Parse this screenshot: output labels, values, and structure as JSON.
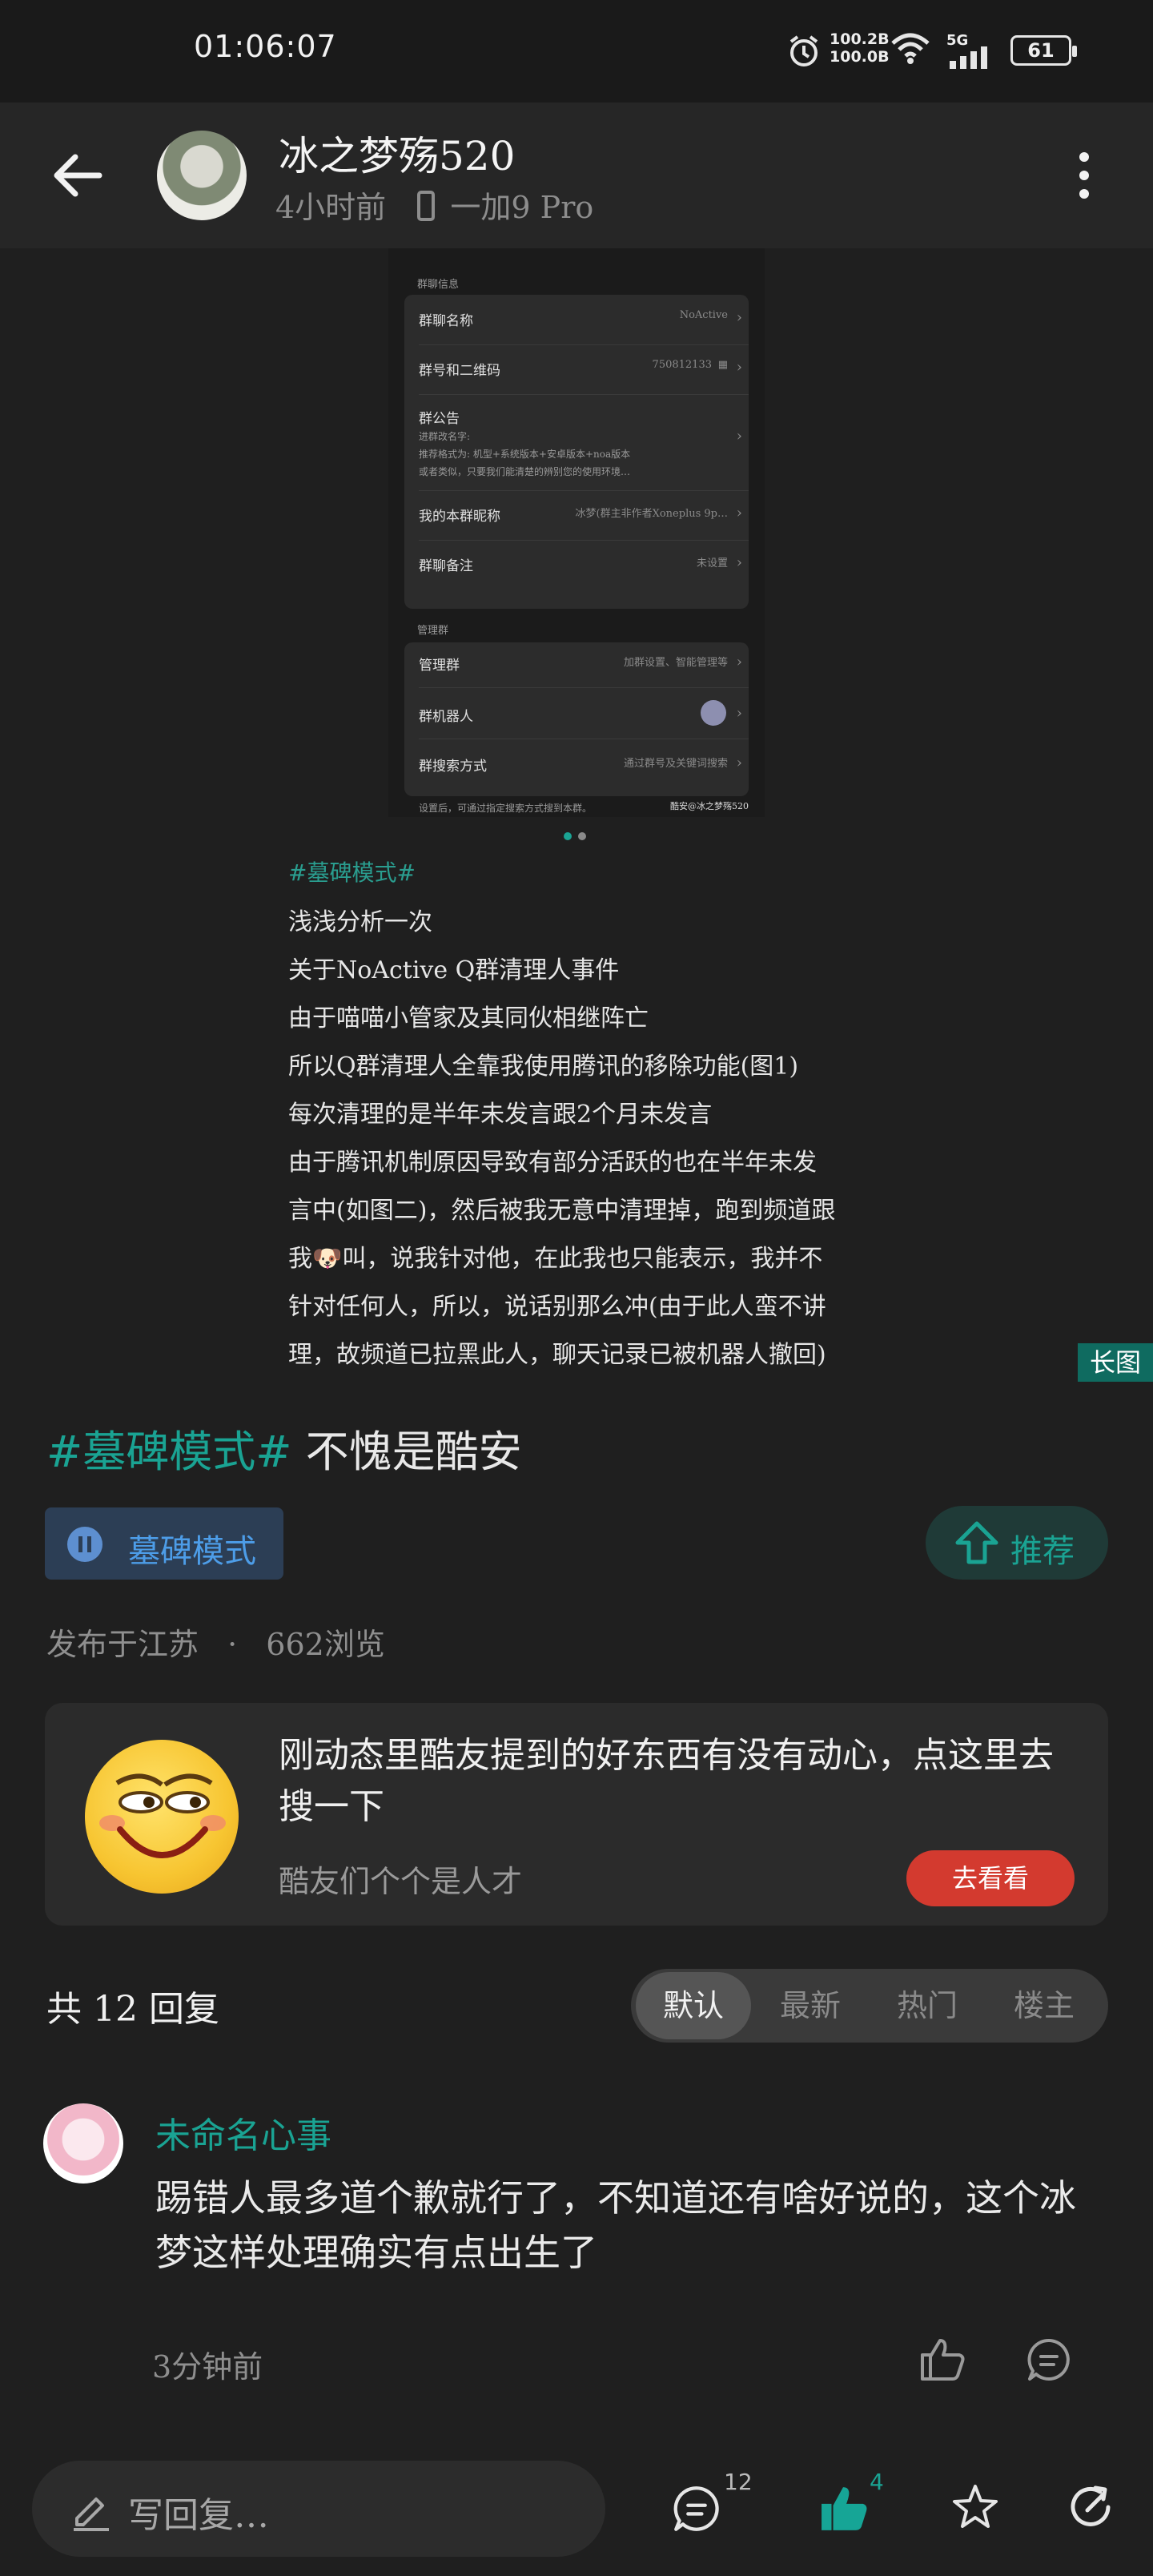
{
  "status_bar": {
    "time": "01:06:07",
    "net_up": "100.2B",
    "net_down": "100.0B",
    "network": "5G",
    "battery": "61"
  },
  "header": {
    "author": "冰之梦殇520",
    "time_ago": "4小时前",
    "device": "一加9 Pro"
  },
  "screenshot": {
    "section_label": "群聊信息",
    "rows": [
      {
        "label": "群聊名称",
        "value": "NoActive"
      },
      {
        "label": "群号和二维码",
        "value": "750812133"
      },
      {
        "label": "群公告",
        "lines": [
          "进群改名字:",
          "推荐格式为: 机型+系统版本+安卓版本+noa版本",
          "或者类似，只要我们能清楚的辨别您的使用环境…"
        ]
      },
      {
        "label": "我的本群昵称",
        "value": "冰梦(群主非作者Xoneplus 9p…"
      },
      {
        "label": "群聊备注",
        "value": "未设置"
      }
    ],
    "section2_label": "管理群",
    "rows2": [
      {
        "label": "管理群",
        "value": "加群设置、智能管理等"
      },
      {
        "label": "群机器人",
        "value": ""
      },
      {
        "label": "群搜索方式",
        "value": "通过群号及关键词搜索"
      }
    ],
    "footer": "设置后，可通过指定搜索方式搜到本群。",
    "watermark": "酷安@冰之梦殇520"
  },
  "post": {
    "tag": "#墓碑模式#",
    "lines": [
      "浅浅分析一次",
      "关于NoActive Q群清理人事件",
      "由于喵喵小管家及其同伙相继阵亡",
      "所以Q群清理人全靠我使用腾讯的移除功能(图1)",
      "每次清理的是半年未发言跟2个月未发言",
      "由于腾讯机制原因导致有部分活跃的也在半年未发",
      "言中(如图二)，然后被我无意中清理掉，跑到频道跟",
      "我🐶叫，说我针对他，在此我也只能表示，我并不",
      "针对任何人，所以，说话别那么冲(由于此人蛮不讲",
      "理，故频道已拉黑此人，聊天记录已被机器人撤回)"
    ],
    "long_image_label": "长图",
    "title_tag": "#墓碑模式#",
    "title_text": "不愧是酷安",
    "topic_chip": "墓碑模式",
    "recommend_label": "推荐",
    "location": "发布于江苏",
    "views": "662浏览"
  },
  "promo": {
    "title": "刚动态里酷友提到的好东西有没有动心，点这里去搜一下",
    "subtitle": "酷友们个个是人才",
    "button": "去看看"
  },
  "replies": {
    "count_label": "共 12 回复",
    "sort_options": [
      "默认",
      "最新",
      "热门",
      "楼主"
    ],
    "active_sort": "默认",
    "items": [
      {
        "user": "未命名心事",
        "text": "踢错人最多道个歉就行了，不知道还有啥好说的，这个冰梦这样处理确实有点出生了",
        "time": "3分钟前"
      }
    ]
  },
  "bottom_bar": {
    "reply_placeholder": "写回复…",
    "comment_count": "12",
    "like_count": "4"
  },
  "colors": {
    "accent": "#1aa393",
    "like": "#16a596",
    "button_red": "#d33a2f",
    "topic_blue": "#4d9de8"
  }
}
